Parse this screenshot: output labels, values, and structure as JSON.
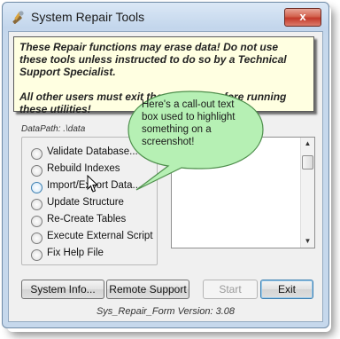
{
  "window": {
    "title": "System Repair Tools",
    "close_label": "x"
  },
  "warning": {
    "line1": "These Repair functions may erase data! Do not use these tools unless instructed to do so by a Technical Support Specialist.",
    "line2": "All other users must exit the program before running these utilities!"
  },
  "datapath": "DataPath: .\\data",
  "options": [
    {
      "label": "Validate Database..."
    },
    {
      "label": "Rebuild Indexes"
    },
    {
      "label": "Import/Export Data..."
    },
    {
      "label": "Update Structure"
    },
    {
      "label": "Re-Create Tables"
    },
    {
      "label": "Execute External Script"
    },
    {
      "label": "Fix Help File"
    }
  ],
  "callout": {
    "text": "Here's a call-out text box used to highlight something on a screenshot!",
    "fill": "#b6f0b4"
  },
  "buttons": {
    "system_info": "System Info...",
    "remote_support": "Remote Support",
    "start": "Start",
    "exit": "Exit"
  },
  "footer": {
    "version": "Sys_Repair_Form Version: 3.08"
  },
  "colors": {
    "warning_bg": "#ffffe1",
    "close_btn": "#c3392a"
  }
}
